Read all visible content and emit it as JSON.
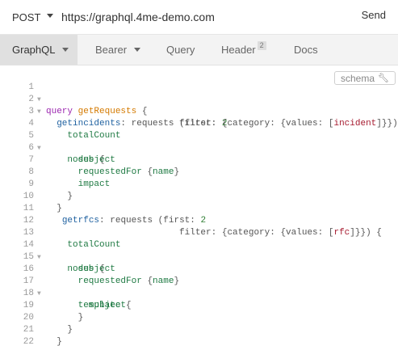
{
  "request": {
    "method": "POST",
    "url": "https://graphql.4me-demo.com",
    "send_label": "Send"
  },
  "tabs": [
    {
      "label": "GraphQL",
      "active": true
    },
    {
      "label": "Bearer"
    },
    {
      "label": "Query"
    },
    {
      "label": "Header",
      "badge": "2"
    },
    {
      "label": "Docs"
    }
  ],
  "editor": {
    "schema_label": "schema",
    "line_numbers": [
      "1",
      "2",
      "3",
      "4",
      "5",
      "6",
      "7",
      "8",
      "9",
      "10",
      "11",
      "12",
      "13",
      "14",
      "15",
      "16",
      "17",
      "18",
      "19",
      "20",
      "21",
      "22"
    ],
    "lines": [
      "query getRequests {",
      "  getincidents: requests (first: 2",
      "                         filter: {category: {values: [incident]}}) {",
      "    totalCount",
      "    nodes {",
      "      subject",
      "      requestedFor {name}",
      "      impact",
      "    }",
      "  }",
      "   getrfcs: requests (first: 2",
      "                         filter: {category: {values: [rfc]}}) {",
      "    totalCount",
      "    nodes {",
      "      subject",
      "      requestedFor {name}",
      "      template {",
      "        subject",
      "      }",
      "    }",
      "  }",
      "}"
    ]
  },
  "colors": {
    "keyword": "#9c27b0",
    "operation_name": "#d47a00",
    "alias": "#1f61a0",
    "field": "#1f7a43",
    "number": "#2e7d32",
    "enum": "#a6192e",
    "active_tab_bg": "#e0e0e0",
    "tab_bar_bg": "#f3f3f3"
  },
  "icons": {
    "method_dropdown": "caret-down-icon",
    "tab_dropdown": "caret-down-icon",
    "schema": "wrench-icon",
    "fold": "fold-arrow-icon"
  }
}
